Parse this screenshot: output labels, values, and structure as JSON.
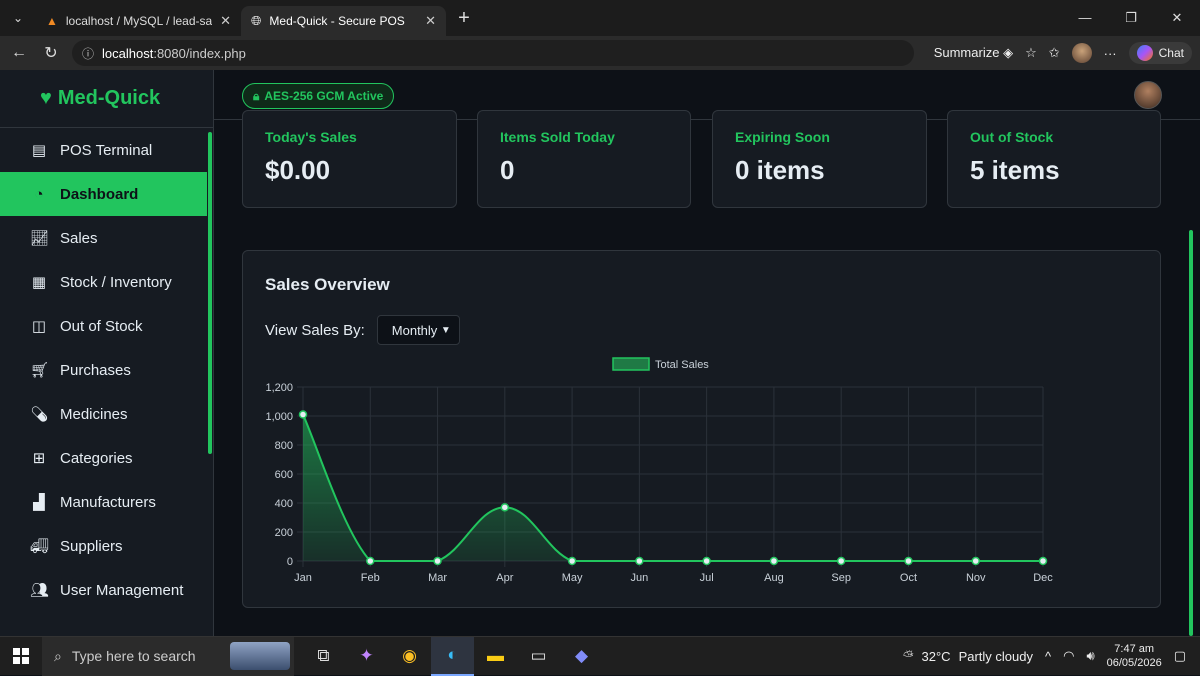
{
  "browser": {
    "tabs": [
      {
        "title": "localhost / MySQL / lead-saas / lea",
        "active": false
      },
      {
        "title": "Med-Quick - Secure POS",
        "active": true
      }
    ],
    "url_host": "localhost",
    "url_path": ":8080/index.php",
    "summarize_label": "Summarize",
    "chat_label": "Chat"
  },
  "app": {
    "brand": "Med-Quick",
    "security_badge": "AES-256 GCM Active",
    "nav": [
      {
        "label": "POS Terminal",
        "icon": "cash-register-icon",
        "active": false
      },
      {
        "label": "Dashboard",
        "icon": "gauge-icon",
        "active": true
      },
      {
        "label": "Sales",
        "icon": "line-chart-icon",
        "active": false
      },
      {
        "label": "Stock / Inventory",
        "icon": "boxes-icon",
        "active": false
      },
      {
        "label": "Out of Stock",
        "icon": "box-open-icon",
        "active": false
      },
      {
        "label": "Purchases",
        "icon": "cart-icon",
        "active": false
      },
      {
        "label": "Medicines",
        "icon": "pills-icon",
        "active": false
      },
      {
        "label": "Categories",
        "icon": "sitemap-icon",
        "active": false
      },
      {
        "label": "Manufacturers",
        "icon": "industry-icon",
        "active": false
      },
      {
        "label": "Suppliers",
        "icon": "truck-icon",
        "active": false
      },
      {
        "label": "User Management",
        "icon": "users-icon",
        "active": false
      }
    ],
    "stats": [
      {
        "label": "Today's Sales",
        "value": "$0.00"
      },
      {
        "label": "Items Sold Today",
        "value": "0"
      },
      {
        "label": "Expiring Soon",
        "value": "0 items"
      },
      {
        "label": "Out of Stock",
        "value": "5 items"
      }
    ],
    "overview": {
      "title": "Sales Overview",
      "view_by_label": "View Sales By:",
      "view_by_selected": "Monthly"
    }
  },
  "chart_data": {
    "type": "area",
    "categories": [
      "Jan",
      "Feb",
      "Mar",
      "Apr",
      "May",
      "Jun",
      "Jul",
      "Aug",
      "Sep",
      "Oct",
      "Nov",
      "Dec"
    ],
    "series": [
      {
        "name": "Total Sales",
        "values": [
          1010,
          0,
          0,
          370,
          0,
          0,
          0,
          0,
          0,
          0,
          0,
          0
        ]
      }
    ],
    "y_ticks": [
      "0",
      "200",
      "400",
      "600",
      "800",
      "1,000",
      "1,200"
    ],
    "ylim": [
      0,
      1200
    ],
    "grid": true,
    "legend": "top-center",
    "color": "#22c55e"
  },
  "taskbar": {
    "search_placeholder": "Type here to search",
    "weather_temp": "32°C",
    "weather_desc": "Partly cloudy",
    "time": "7:47 am",
    "date": "06/05/2026"
  }
}
